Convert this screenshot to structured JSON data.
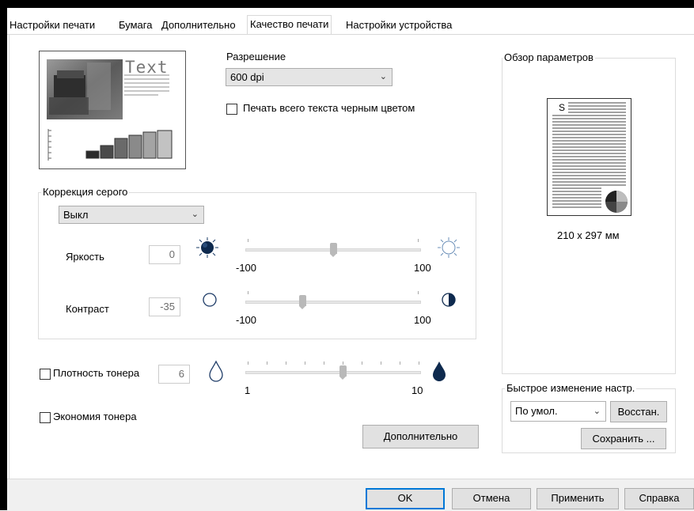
{
  "tabs": [
    "Настройки печати",
    "Бумага",
    "Дополнительно",
    "Качество печати",
    "Настройки устройства"
  ],
  "active_tab": "Качество печати",
  "preview": {
    "word": "Text"
  },
  "resolution": {
    "label": "Разрешение",
    "value": "600 dpi"
  },
  "print_black_text": {
    "label": "Печать всего текста черным цветом",
    "checked": false
  },
  "gray_correction": {
    "title": "Коррекция серого",
    "mode": "Выкл",
    "brightness": {
      "label": "Яркость",
      "value": "0",
      "min_label": "-100",
      "max_label": "100",
      "level_fraction": 0.5
    },
    "contrast": {
      "label": "Контраст",
      "value": "-35",
      "min_label": "-100",
      "max_label": "100",
      "level_fraction": 0.325
    }
  },
  "toner_density": {
    "label": "Плотность тонера",
    "checked": false,
    "value": "6",
    "min_label": "1",
    "max_label": "10",
    "level": 6
  },
  "toner_save": {
    "label": "Экономия тонера",
    "checked": false
  },
  "advanced_button": "Дополнительно",
  "overview": {
    "title": "Обзор параметров",
    "page_letter": "S",
    "paper_size": "210 x 297 мм"
  },
  "quick_change": {
    "title": "Быстрое изменение настр.",
    "preset": "По умол.",
    "restore_button": "Восстан.",
    "save_button": "Сохранить ..."
  },
  "buttons": {
    "ok": "OK",
    "cancel": "Отмена",
    "apply": "Применить",
    "help": "Справка"
  }
}
